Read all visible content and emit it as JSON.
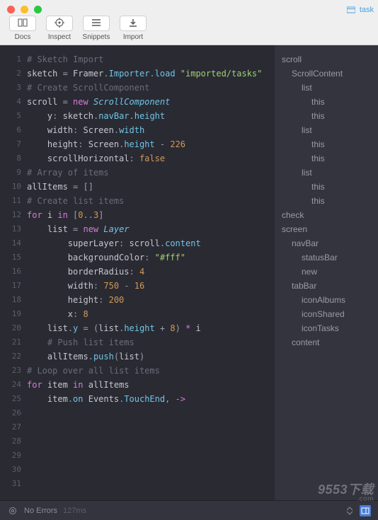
{
  "window": {
    "file_label": "task"
  },
  "toolbar": {
    "docs": "Docs",
    "inspect": "Inspect",
    "snippets": "Snippets",
    "import": "Import"
  },
  "code": {
    "lines": [
      {
        "n": 1,
        "seg": [
          {
            "c": "tok-comment",
            "t": "# Sketch Import"
          }
        ]
      },
      {
        "n": 2,
        "seg": [
          {
            "c": "tok-var",
            "t": "sketch "
          },
          {
            "c": "tok-op",
            "t": "="
          },
          {
            "c": "tok-var",
            "t": " Framer"
          },
          {
            "c": "tok-op",
            "t": "."
          },
          {
            "c": "tok-method",
            "t": "Importer"
          },
          {
            "c": "tok-op",
            "t": "."
          },
          {
            "c": "tok-method",
            "t": "load "
          },
          {
            "c": "tok-str",
            "t": "\"imported/tasks\""
          }
        ]
      },
      {
        "n": 3,
        "seg": [
          {
            "c": "",
            "t": ""
          }
        ]
      },
      {
        "n": 4,
        "seg": [
          {
            "c": "tok-comment",
            "t": "# Create ScrollComponent"
          }
        ]
      },
      {
        "n": 5,
        "seg": [
          {
            "c": "tok-var",
            "t": "scroll "
          },
          {
            "c": "tok-op",
            "t": "="
          },
          {
            "c": "tok-kw",
            "t": " new "
          },
          {
            "c": "tok-class",
            "t": "ScrollComponent"
          }
        ]
      },
      {
        "n": 6,
        "seg": [
          {
            "c": "",
            "t": "    "
          },
          {
            "c": "tok-prop",
            "t": "y"
          },
          {
            "c": "tok-op",
            "t": ": "
          },
          {
            "c": "tok-var",
            "t": "sketch"
          },
          {
            "c": "tok-op",
            "t": "."
          },
          {
            "c": "tok-method",
            "t": "navBar"
          },
          {
            "c": "tok-op",
            "t": "."
          },
          {
            "c": "tok-method",
            "t": "height"
          }
        ]
      },
      {
        "n": 7,
        "seg": [
          {
            "c": "",
            "t": "    "
          },
          {
            "c": "tok-prop",
            "t": "width"
          },
          {
            "c": "tok-op",
            "t": ": "
          },
          {
            "c": "tok-var",
            "t": "Screen"
          },
          {
            "c": "tok-op",
            "t": "."
          },
          {
            "c": "tok-method",
            "t": "width"
          }
        ]
      },
      {
        "n": 8,
        "seg": [
          {
            "c": "",
            "t": "    "
          },
          {
            "c": "tok-prop",
            "t": "height"
          },
          {
            "c": "tok-op",
            "t": ": "
          },
          {
            "c": "tok-var",
            "t": "Screen"
          },
          {
            "c": "tok-op",
            "t": "."
          },
          {
            "c": "tok-method",
            "t": "height"
          },
          {
            "c": "tok-op",
            "t": " - "
          },
          {
            "c": "tok-num",
            "t": "226"
          }
        ]
      },
      {
        "n": 9,
        "seg": [
          {
            "c": "",
            "t": "    "
          },
          {
            "c": "tok-prop",
            "t": "scrollHorizontal"
          },
          {
            "c": "tok-op",
            "t": ": "
          },
          {
            "c": "tok-bool",
            "t": "false"
          }
        ]
      },
      {
        "n": 10,
        "seg": [
          {
            "c": "",
            "t": ""
          }
        ]
      },
      {
        "n": 11,
        "seg": [
          {
            "c": "tok-comment",
            "t": "# Array of items"
          }
        ]
      },
      {
        "n": 12,
        "seg": [
          {
            "c": "tok-var",
            "t": "allItems "
          },
          {
            "c": "tok-op",
            "t": "= []"
          }
        ]
      },
      {
        "n": 13,
        "seg": [
          {
            "c": "",
            "t": ""
          }
        ]
      },
      {
        "n": 14,
        "seg": [
          {
            "c": "tok-comment",
            "t": "# Create list items"
          }
        ]
      },
      {
        "n": 15,
        "seg": [
          {
            "c": "tok-kw",
            "t": "for "
          },
          {
            "c": "tok-var",
            "t": "i "
          },
          {
            "c": "tok-kw",
            "t": "in "
          },
          {
            "c": "tok-op",
            "t": "["
          },
          {
            "c": "tok-num",
            "t": "0"
          },
          {
            "c": "tok-op",
            "t": ".."
          },
          {
            "c": "tok-num",
            "t": "3"
          },
          {
            "c": "tok-op",
            "t": "]"
          }
        ]
      },
      {
        "n": 16,
        "seg": [
          {
            "c": "",
            "t": "    "
          },
          {
            "c": "tok-var",
            "t": "list "
          },
          {
            "c": "tok-op",
            "t": "= "
          },
          {
            "c": "tok-kw",
            "t": "new "
          },
          {
            "c": "tok-class",
            "t": "Layer"
          }
        ]
      },
      {
        "n": 17,
        "seg": [
          {
            "c": "",
            "t": "        "
          },
          {
            "c": "tok-prop",
            "t": "superLayer"
          },
          {
            "c": "tok-op",
            "t": ": "
          },
          {
            "c": "tok-var",
            "t": "scroll"
          },
          {
            "c": "tok-op",
            "t": "."
          },
          {
            "c": "tok-method",
            "t": "content"
          }
        ]
      },
      {
        "n": 18,
        "seg": [
          {
            "c": "",
            "t": "        "
          },
          {
            "c": "tok-prop",
            "t": "backgroundColor"
          },
          {
            "c": "tok-op",
            "t": ": "
          },
          {
            "c": "tok-str",
            "t": "\"#fff\""
          }
        ]
      },
      {
        "n": 19,
        "seg": [
          {
            "c": "",
            "t": "        "
          },
          {
            "c": "tok-prop",
            "t": "borderRadius"
          },
          {
            "c": "tok-op",
            "t": ": "
          },
          {
            "c": "tok-num",
            "t": "4"
          }
        ]
      },
      {
        "n": 20,
        "seg": [
          {
            "c": "",
            "t": "        "
          },
          {
            "c": "tok-prop",
            "t": "width"
          },
          {
            "c": "tok-op",
            "t": ": "
          },
          {
            "c": "tok-num",
            "t": "750"
          },
          {
            "c": "tok-op",
            "t": " - "
          },
          {
            "c": "tok-num",
            "t": "16"
          }
        ]
      },
      {
        "n": 21,
        "seg": [
          {
            "c": "",
            "t": "        "
          },
          {
            "c": "tok-prop",
            "t": "height"
          },
          {
            "c": "tok-op",
            "t": ": "
          },
          {
            "c": "tok-num",
            "t": "200"
          }
        ]
      },
      {
        "n": 22,
        "seg": [
          {
            "c": "",
            "t": "        "
          },
          {
            "c": "tok-prop",
            "t": "x"
          },
          {
            "c": "tok-op",
            "t": ": "
          },
          {
            "c": "tok-num",
            "t": "8"
          }
        ]
      },
      {
        "n": 23,
        "seg": [
          {
            "c": "",
            "t": ""
          }
        ]
      },
      {
        "n": 24,
        "seg": [
          {
            "c": "",
            "t": "    "
          },
          {
            "c": "tok-var",
            "t": "list"
          },
          {
            "c": "tok-op",
            "t": "."
          },
          {
            "c": "tok-method",
            "t": "y"
          },
          {
            "c": "tok-op",
            "t": " = ("
          },
          {
            "c": "tok-var",
            "t": "list"
          },
          {
            "c": "tok-op",
            "t": "."
          },
          {
            "c": "tok-method",
            "t": "height"
          },
          {
            "c": "tok-op",
            "t": " + "
          },
          {
            "c": "tok-num",
            "t": "8"
          },
          {
            "c": "tok-op",
            "t": ") "
          },
          {
            "c": "tok-kw",
            "t": "*"
          },
          {
            "c": "tok-var",
            "t": " i"
          }
        ]
      },
      {
        "n": 25,
        "seg": [
          {
            "c": "",
            "t": ""
          }
        ]
      },
      {
        "n": 26,
        "seg": [
          {
            "c": "",
            "t": "    "
          },
          {
            "c": "tok-comment",
            "t": "# Push list items"
          }
        ]
      },
      {
        "n": 27,
        "seg": [
          {
            "c": "",
            "t": "    "
          },
          {
            "c": "tok-var",
            "t": "allItems"
          },
          {
            "c": "tok-op",
            "t": "."
          },
          {
            "c": "tok-method",
            "t": "push"
          },
          {
            "c": "tok-op",
            "t": "("
          },
          {
            "c": "tok-var",
            "t": "list"
          },
          {
            "c": "tok-op",
            "t": ")"
          }
        ]
      },
      {
        "n": 28,
        "seg": [
          {
            "c": "",
            "t": ""
          }
        ]
      },
      {
        "n": 29,
        "seg": [
          {
            "c": "tok-comment",
            "t": "# Loop over all list items"
          }
        ]
      },
      {
        "n": 30,
        "seg": [
          {
            "c": "tok-kw",
            "t": "for "
          },
          {
            "c": "tok-var",
            "t": "item "
          },
          {
            "c": "tok-kw",
            "t": "in "
          },
          {
            "c": "tok-var",
            "t": "allItems"
          }
        ]
      },
      {
        "n": 31,
        "seg": [
          {
            "c": "",
            "t": "    "
          },
          {
            "c": "tok-var",
            "t": "item"
          },
          {
            "c": "tok-op",
            "t": "."
          },
          {
            "c": "tok-method",
            "t": "on"
          },
          {
            "c": "tok-var",
            "t": " Events"
          },
          {
            "c": "tok-op",
            "t": "."
          },
          {
            "c": "tok-method",
            "t": "TouchEnd"
          },
          {
            "c": "tok-op",
            "t": ", "
          },
          {
            "c": "tok-kw",
            "t": "->"
          }
        ]
      }
    ]
  },
  "outline": {
    "items": [
      {
        "level": 0,
        "label": "scroll"
      },
      {
        "level": 1,
        "label": "ScrollContent"
      },
      {
        "level": 2,
        "label": "list"
      },
      {
        "level": 3,
        "label": "this"
      },
      {
        "level": 3,
        "label": "this"
      },
      {
        "level": 2,
        "label": "list"
      },
      {
        "level": 3,
        "label": "this"
      },
      {
        "level": 3,
        "label": "this"
      },
      {
        "level": 2,
        "label": "list"
      },
      {
        "level": 3,
        "label": "this"
      },
      {
        "level": 3,
        "label": "this"
      },
      {
        "level": 0,
        "label": "check"
      },
      {
        "level": 0,
        "label": "screen"
      },
      {
        "level": 1,
        "label": "navBar"
      },
      {
        "level": 2,
        "label": "statusBar"
      },
      {
        "level": 2,
        "label": "new"
      },
      {
        "level": 1,
        "label": "tabBar"
      },
      {
        "level": 2,
        "label": "iconAlbums"
      },
      {
        "level": 2,
        "label": "iconShared"
      },
      {
        "level": 2,
        "label": "iconTasks"
      },
      {
        "level": 1,
        "label": "content"
      }
    ]
  },
  "status": {
    "errors": "No Errors",
    "time": "127ms"
  },
  "watermark": {
    "main": "9553下载",
    "sub": ".com"
  }
}
